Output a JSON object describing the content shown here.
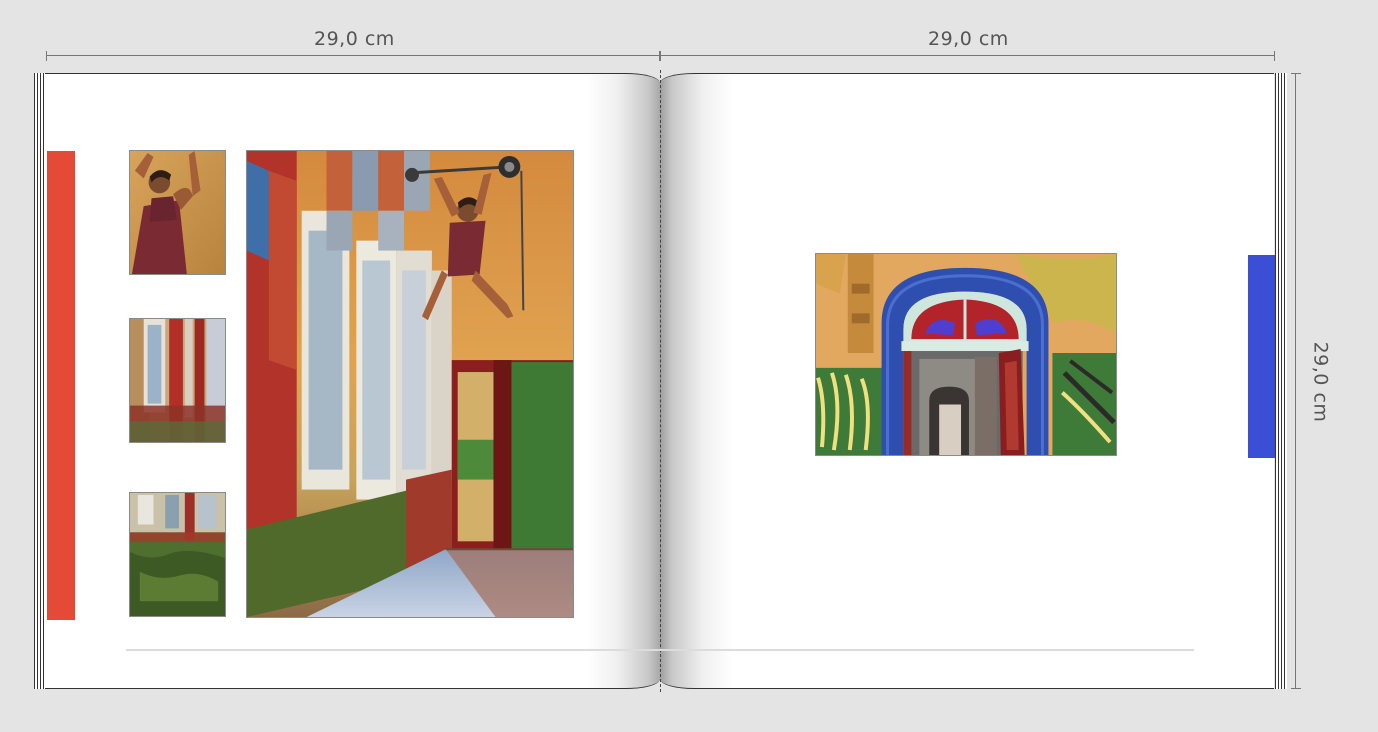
{
  "dimensions": {
    "left_width_label": "29,0 cm",
    "right_width_label": "29,0 cm",
    "height_label": "29,0 cm"
  },
  "colors": {
    "background": "#e4e4e4",
    "red_marker": "#e54a36",
    "blue_marker": "#3a4fd6",
    "ruler": "#777777"
  },
  "pages": {
    "left": {
      "photos": [
        "weightlifter-mural-thumbnail",
        "window-corridor-thumbnail",
        "green-wall-thumbnail",
        "weightlifter-room-main-photo"
      ]
    },
    "right": {
      "photos": [
        "blue-arched-doorway-photo"
      ]
    }
  }
}
